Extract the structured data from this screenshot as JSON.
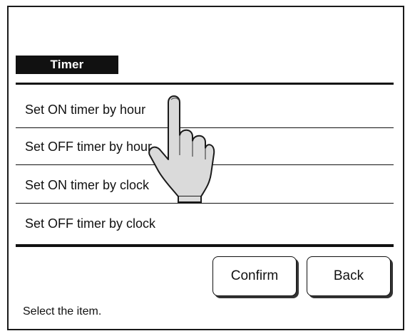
{
  "menu": {
    "title": "Timer",
    "items": [
      {
        "label": "Set ON timer by hour"
      },
      {
        "label": "Set OFF timer by hour"
      },
      {
        "label": "Set ON timer by clock"
      },
      {
        "label": "Set OFF timer by clock"
      }
    ]
  },
  "buttons": {
    "confirm_label": "Confirm",
    "back_label": "Back"
  },
  "status": {
    "message": "Select the item."
  },
  "pointer": {
    "icon": "pointing-hand-icon"
  }
}
